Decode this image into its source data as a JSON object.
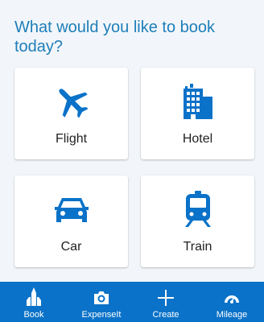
{
  "page": {
    "heading": "What would you like to book today?"
  },
  "cards": {
    "flight": {
      "label": "Flight",
      "icon": "airplane-icon"
    },
    "hotel": {
      "label": "Hotel",
      "icon": "hotel-building-icon"
    },
    "car": {
      "label": "Car",
      "icon": "car-icon"
    },
    "train": {
      "label": "Train",
      "icon": "train-icon"
    }
  },
  "bottom_nav": {
    "items": [
      {
        "label": "Book",
        "icon": "book-tower-icon",
        "active": true
      },
      {
        "label": "ExpenseIt",
        "icon": "camera-icon",
        "active": false
      },
      {
        "label": "Create",
        "icon": "plus-icon",
        "active": false
      },
      {
        "label": "Mileage",
        "icon": "speedometer-icon",
        "active": false
      }
    ]
  },
  "colors": {
    "accent": "#1e7eb8",
    "icon_blue": "#0a72c8",
    "nav_background": "#0a72c8",
    "page_background": "#f2f6fa"
  }
}
